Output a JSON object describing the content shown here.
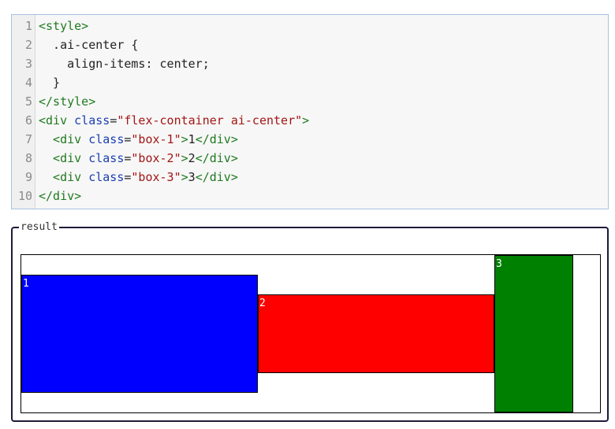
{
  "code": {
    "lines": [
      {
        "num": "1",
        "parts": [
          {
            "t": "tag",
            "v": "<style>"
          }
        ]
      },
      {
        "num": "2",
        "parts": [
          {
            "t": "plain",
            "v": "  .ai-center {"
          }
        ]
      },
      {
        "num": "3",
        "parts": [
          {
            "t": "plain",
            "v": "    align-items: center;"
          }
        ]
      },
      {
        "num": "4",
        "parts": [
          {
            "t": "plain",
            "v": "  }"
          }
        ]
      },
      {
        "num": "5",
        "parts": [
          {
            "t": "tag",
            "v": "</style>"
          }
        ]
      },
      {
        "num": "6",
        "parts": [
          {
            "t": "tag",
            "v": "<div "
          },
          {
            "t": "attr",
            "v": "class"
          },
          {
            "t": "plain",
            "v": "="
          },
          {
            "t": "str",
            "v": "\"flex-container ai-center\""
          },
          {
            "t": "tag",
            "v": ">"
          }
        ]
      },
      {
        "num": "7",
        "parts": [
          {
            "t": "tag",
            "v": "  <div "
          },
          {
            "t": "attr",
            "v": "class"
          },
          {
            "t": "plain",
            "v": "="
          },
          {
            "t": "str",
            "v": "\"box-1\""
          },
          {
            "t": "tag",
            "v": ">"
          },
          {
            "t": "plain",
            "v": "1"
          },
          {
            "t": "tag",
            "v": "</div>"
          }
        ]
      },
      {
        "num": "8",
        "parts": [
          {
            "t": "tag",
            "v": "  <div "
          },
          {
            "t": "attr",
            "v": "class"
          },
          {
            "t": "plain",
            "v": "="
          },
          {
            "t": "str",
            "v": "\"box-2\""
          },
          {
            "t": "tag",
            "v": ">"
          },
          {
            "t": "plain",
            "v": "2"
          },
          {
            "t": "tag",
            "v": "</div>"
          }
        ]
      },
      {
        "num": "9",
        "parts": [
          {
            "t": "tag",
            "v": "  <div "
          },
          {
            "t": "attr",
            "v": "class"
          },
          {
            "t": "plain",
            "v": "="
          },
          {
            "t": "str",
            "v": "\"box-3\""
          },
          {
            "t": "tag",
            "v": ">"
          },
          {
            "t": "plain",
            "v": "3"
          },
          {
            "t": "tag",
            "v": "</div>"
          }
        ]
      },
      {
        "num": "10",
        "parts": [
          {
            "t": "tag",
            "v": "</div>"
          }
        ]
      }
    ]
  },
  "result": {
    "legend": "result",
    "boxes": [
      "1",
      "2",
      "3"
    ]
  },
  "colors": {
    "box_1": "#0000ff",
    "box_2": "#ff0000",
    "box_3": "#008000",
    "tag": "#1f7a1f",
    "attr": "#1a3fb0",
    "string": "#a31515"
  }
}
